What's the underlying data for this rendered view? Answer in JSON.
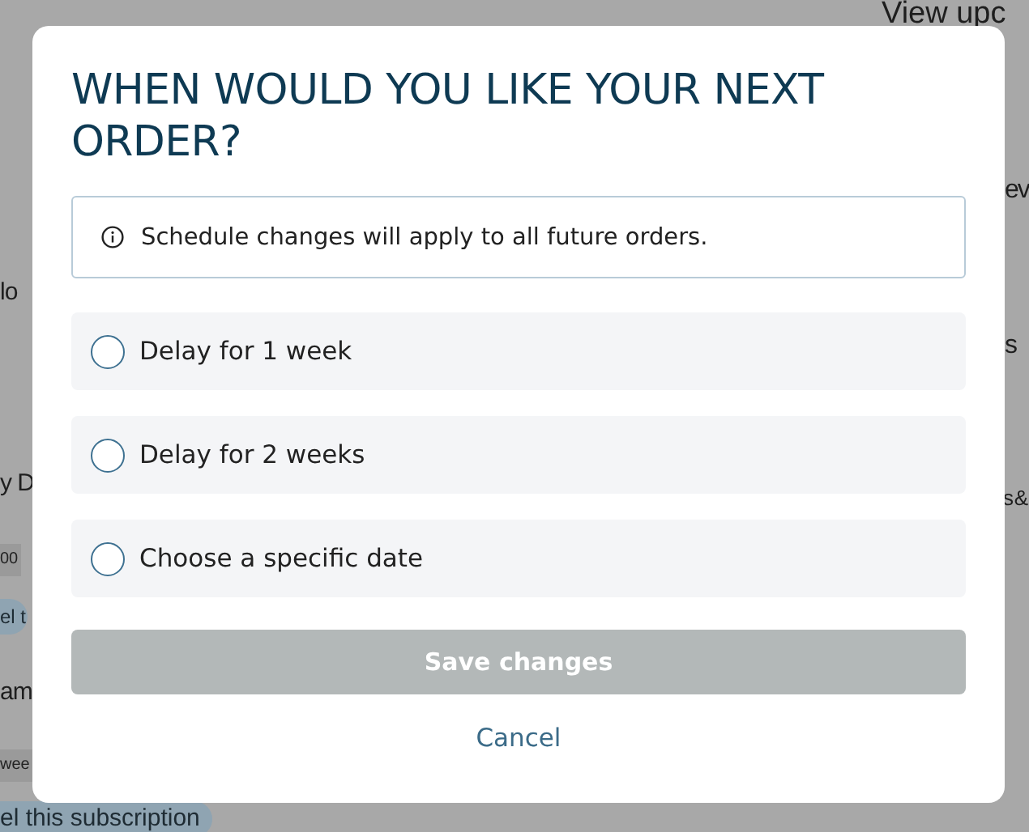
{
  "background": {
    "left_texts": [
      {
        "text": "lo",
        "kind": "heading"
      },
      {
        "text": "y D",
        "kind": "heading"
      },
      {
        "text": "00",
        "kind": "chip"
      },
      {
        "text": "el t",
        "kind": "link-chip"
      },
      {
        "text": "am",
        "kind": "heading"
      },
      {
        "text": "wee",
        "kind": "chip"
      },
      {
        "text": "el this subscription",
        "kind": "link-chip"
      }
    ],
    "right_texts": [
      {
        "text": "View upc",
        "kind": "heading"
      },
      {
        "text": "ev",
        "kind": "heading"
      },
      {
        "text": "s",
        "kind": "heading"
      },
      {
        "text": "s &",
        "kind": "heading"
      }
    ]
  },
  "dialog": {
    "title": "WHEN WOULD YOU LIKE YOUR NEXT ORDER?",
    "notice": "Schedule changes will apply to all future orders.",
    "options": [
      {
        "label": "Delay for 1 week",
        "selected": false
      },
      {
        "label": "Delay for 2 weeks",
        "selected": false
      },
      {
        "label": "Choose a specific date",
        "selected": false
      }
    ],
    "save_button": {
      "label": "Save changes",
      "disabled": true
    },
    "cancel_link": "Cancel"
  }
}
